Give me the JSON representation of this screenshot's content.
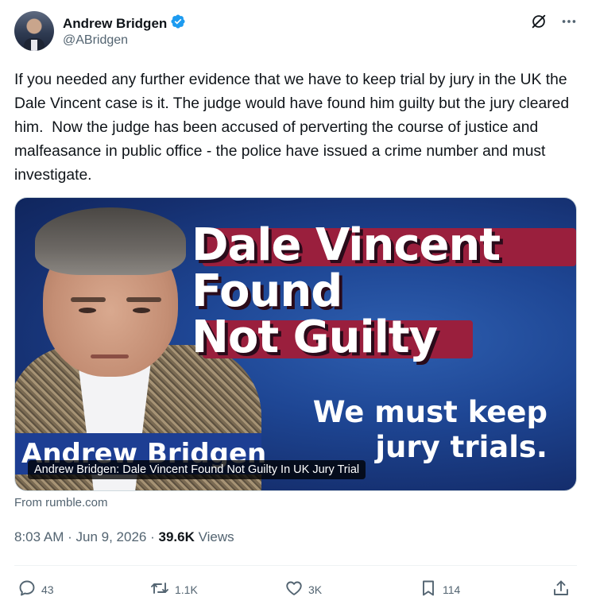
{
  "author": {
    "name": "Andrew Bridgen",
    "handle": "@ABridgen",
    "verified": true
  },
  "tweet": {
    "text": "If you needed any further evidence that we have to keep trial by jury in the UK the Dale Vincent case is it. The judge would have found him guilty but the jury cleared him.  Now the judge has been accused of perverting the course of justice and malfeasance in public office - the police have issued a crime number and must investigate."
  },
  "media_card": {
    "headline_lines": [
      "Dale Vincent",
      "Found",
      "Not Guilty"
    ],
    "sub_lines": [
      "We must keep",
      "jury trials."
    ],
    "nameplate": "Andrew Bridgen",
    "caption": "Andrew Bridgen: Dale Vincent Found Not Guilty In UK Jury Trial",
    "source": "From rumble.com"
  },
  "meta": {
    "time": "8:03 AM",
    "sep1": "·",
    "date": "Jun 9, 2026",
    "sep2": "·",
    "views_count": "39.6K",
    "views_label": "Views"
  },
  "actions": {
    "replies": "43",
    "reposts": "1.1K",
    "likes": "3K",
    "bookmarks": "114"
  },
  "icons": {
    "verified": "verified-badge-icon",
    "grok": "grok-icon",
    "more": "more-icon",
    "reply": "reply-icon",
    "repost": "repost-icon",
    "like": "heart-icon",
    "bookmark": "bookmark-icon",
    "share": "share-icon"
  },
  "colors": {
    "text": "#0f1419",
    "secondary": "#536471",
    "verified": "#1d9bf0",
    "card_bg": "#1e4694",
    "headline_band": "#9a1f3d"
  }
}
